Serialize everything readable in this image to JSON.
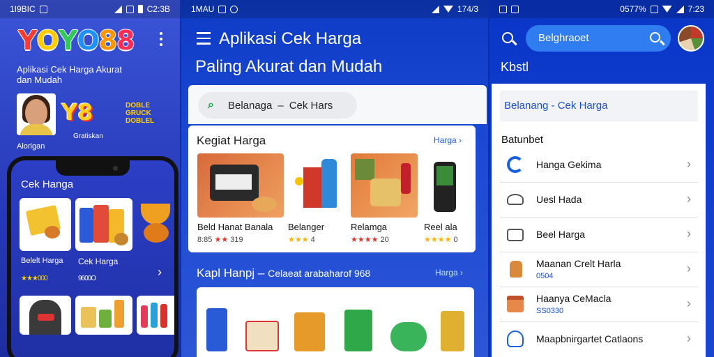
{
  "left": {
    "status": {
      "left": "1I9BIC",
      "right": "C2:3B"
    },
    "logo": {
      "letters": [
        "Y",
        "O",
        "Y",
        "O",
        "8",
        "8"
      ],
      "colors": [
        "#ff3b30",
        "#ffcc00",
        "#34c759",
        "#1e90ff",
        "#ff9500",
        "#ff2d55"
      ]
    },
    "tagline": "Aplikasi Cek Harga Akurat dan Mudah",
    "y8_logo": "Y8",
    "promo_text": "DOBLE GRUCK DOBLEL",
    "promo_sub": "Gratiskan",
    "caption": "Alorigan",
    "phone_header": "Cek Hanga",
    "products": [
      {
        "label": "Belelt Harga",
        "rating": "★★★000"
      },
      {
        "label": "Cek Harga",
        "rating": "9600O"
      }
    ]
  },
  "middle": {
    "status": {
      "left": "1MAU",
      "right": "174/3"
    },
    "title_line1": "Aplikasi Cek Harga",
    "title_line2": "Paling Akurat dan Mudah",
    "search": {
      "prefix": "Belanaga",
      "separator": "–",
      "suffix": "Cek Hars"
    },
    "section1": {
      "title": "Kegiat Harga",
      "link": "Harga"
    },
    "items": [
      {
        "name": "Beld Hanat Banala",
        "rating_stars": "★★",
        "rating_text": "8:85",
        "rating_tail": "319"
      },
      {
        "name": "Belanger",
        "rating_stars": "★★★",
        "rating_text": "",
        "rating_tail": "4"
      },
      {
        "name": "Relamga",
        "rating_stars": "★★★★",
        "rating_text": "",
        "rating_tail": "20"
      },
      {
        "name": "Reel ala",
        "rating_stars": "★★★★",
        "rating_text": "",
        "rating_tail": "0"
      }
    ],
    "section2": {
      "title": "Kapl Hanpj",
      "sep": "–",
      "subtitle": "Celaeat arabaharof 968",
      "link": "Harga"
    }
  },
  "right": {
    "status": {
      "left": "",
      "right": "7:23",
      "battery": "0577%"
    },
    "search_value": "Belghraoet",
    "kbstl": "Kbstl",
    "header": "Belanang - Cek Harga",
    "category": "Batunbet",
    "rows": [
      {
        "label": "Hanga Gekima",
        "sub": "",
        "icon": "refresh-icon"
      },
      {
        "label": "Uesl Hada",
        "sub": "",
        "icon": "scale-icon"
      },
      {
        "label": "Beel Harga",
        "sub": "",
        "icon": "wallet-icon"
      },
      {
        "label": "Maanan Crelt Harla",
        "sub": "0504",
        "icon": "bottle-icon"
      },
      {
        "label": "Haanya CeMacla",
        "sub": "SS0330",
        "icon": "shop-icon"
      },
      {
        "label": "Maapbnirgartet Catlaons",
        "sub": "",
        "icon": "person-icon"
      }
    ]
  }
}
